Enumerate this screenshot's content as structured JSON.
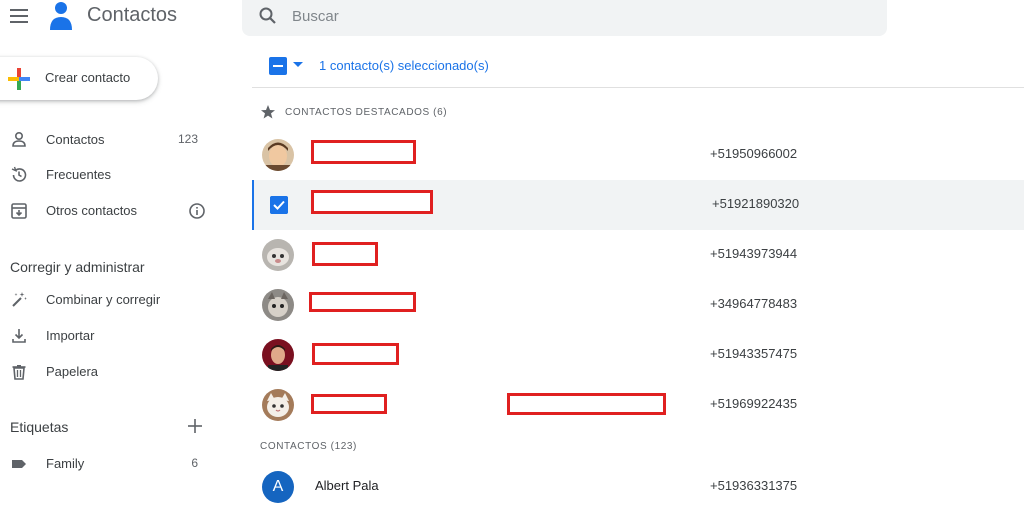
{
  "app": {
    "title": "Contactos"
  },
  "search": {
    "placeholder": "Buscar"
  },
  "sidebar": {
    "create_label": "Crear contacto",
    "items": [
      {
        "label": "Contactos",
        "count": "123",
        "icon": "person-icon"
      },
      {
        "label": "Frecuentes",
        "icon": "history-icon"
      },
      {
        "label": "Otros contactos",
        "icon": "archive-down-icon"
      }
    ],
    "manage_title": "Corregir y administrar",
    "manage_items": [
      {
        "label": "Combinar y corregir",
        "icon": "magic-wand-icon"
      },
      {
        "label": "Importar",
        "icon": "download-icon"
      },
      {
        "label": "Papelera",
        "icon": "trash-icon"
      }
    ],
    "labels_title": "Etiquetas",
    "labels": [
      {
        "label": "Family",
        "count": "6",
        "icon": "label-icon"
      }
    ]
  },
  "main": {
    "selection_text": "1 contacto(s) seleccionado(s)",
    "starred_header": "CONTACTOS DESTACADOS (6)",
    "contacts_header": "CONTACTOS (123)",
    "starred": [
      {
        "phone": "+51950966002"
      },
      {
        "phone": "+51921890320"
      },
      {
        "phone": "+51943973944"
      },
      {
        "phone": "+34964778483"
      },
      {
        "phone": "+51943357475"
      },
      {
        "phone": "+51969922435"
      }
    ],
    "contacts": [
      {
        "initial": "A",
        "name": "Albert Pala",
        "phone": "+51936331375"
      }
    ]
  },
  "colors": {
    "accent": "#1a73e8",
    "redaction": "#e02020",
    "avatar_a": "#1565c0"
  }
}
